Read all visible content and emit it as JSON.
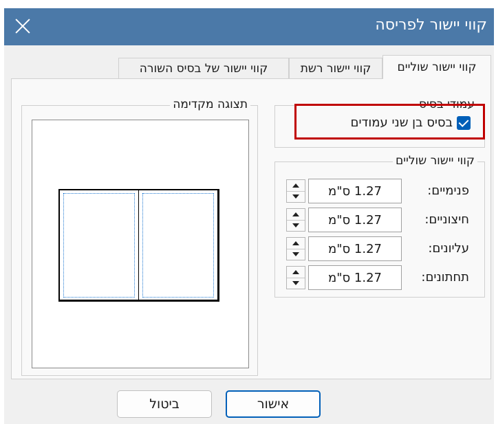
{
  "dialog": {
    "title": "קווי יישור לפריסה"
  },
  "tabs": [
    {
      "label": "קווי יישור שוליים"
    },
    {
      "label": "קווי יישור רשת"
    },
    {
      "label": "קווי יישור של בסיס השורה"
    }
  ],
  "preview": {
    "legend": "תצוגה מקדימה"
  },
  "master_pages": {
    "legend": "עמודי בסיס",
    "two_page_label": "בסיס בן שני עמודים",
    "two_page_checked": true
  },
  "margin_guides": {
    "legend": "קווי יישור שוליים",
    "rows": [
      {
        "label": "פנימיים:",
        "value": "1.27 ס\"מ"
      },
      {
        "label": "חיצוניים:",
        "value": "1.27 ס\"מ"
      },
      {
        "label": "עליונים:",
        "value": "1.27 ס\"מ"
      },
      {
        "label": "תחתונים:",
        "value": "1.27 ס\"מ"
      }
    ]
  },
  "buttons": {
    "ok": "אישור",
    "cancel": "ביטול"
  },
  "colors": {
    "titlebar": "#4b79a8",
    "accent": "#005fb8",
    "highlight": "#c00000",
    "guide": "#1e78d2"
  }
}
